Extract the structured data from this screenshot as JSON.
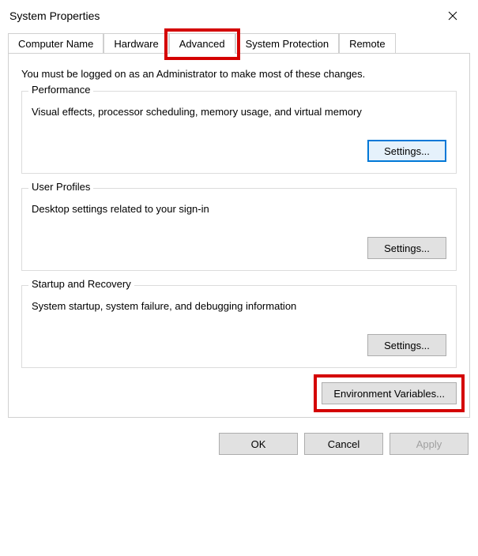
{
  "window": {
    "title": "System Properties"
  },
  "tabs": {
    "computer_name": "Computer Name",
    "hardware": "Hardware",
    "advanced": "Advanced",
    "system_protection": "System Protection",
    "remote": "Remote"
  },
  "content": {
    "notice": "You must be logged on as an Administrator to make most of these changes.",
    "performance": {
      "legend": "Performance",
      "desc": "Visual effects, processor scheduling, memory usage, and virtual memory",
      "button": "Settings..."
    },
    "user_profiles": {
      "legend": "User Profiles",
      "desc": "Desktop settings related to your sign-in",
      "button": "Settings..."
    },
    "startup_recovery": {
      "legend": "Startup and Recovery",
      "desc": "System startup, system failure, and debugging information",
      "button": "Settings..."
    },
    "env_vars_button": "Environment Variables..."
  },
  "buttons": {
    "ok": "OK",
    "cancel": "Cancel",
    "apply": "Apply"
  }
}
